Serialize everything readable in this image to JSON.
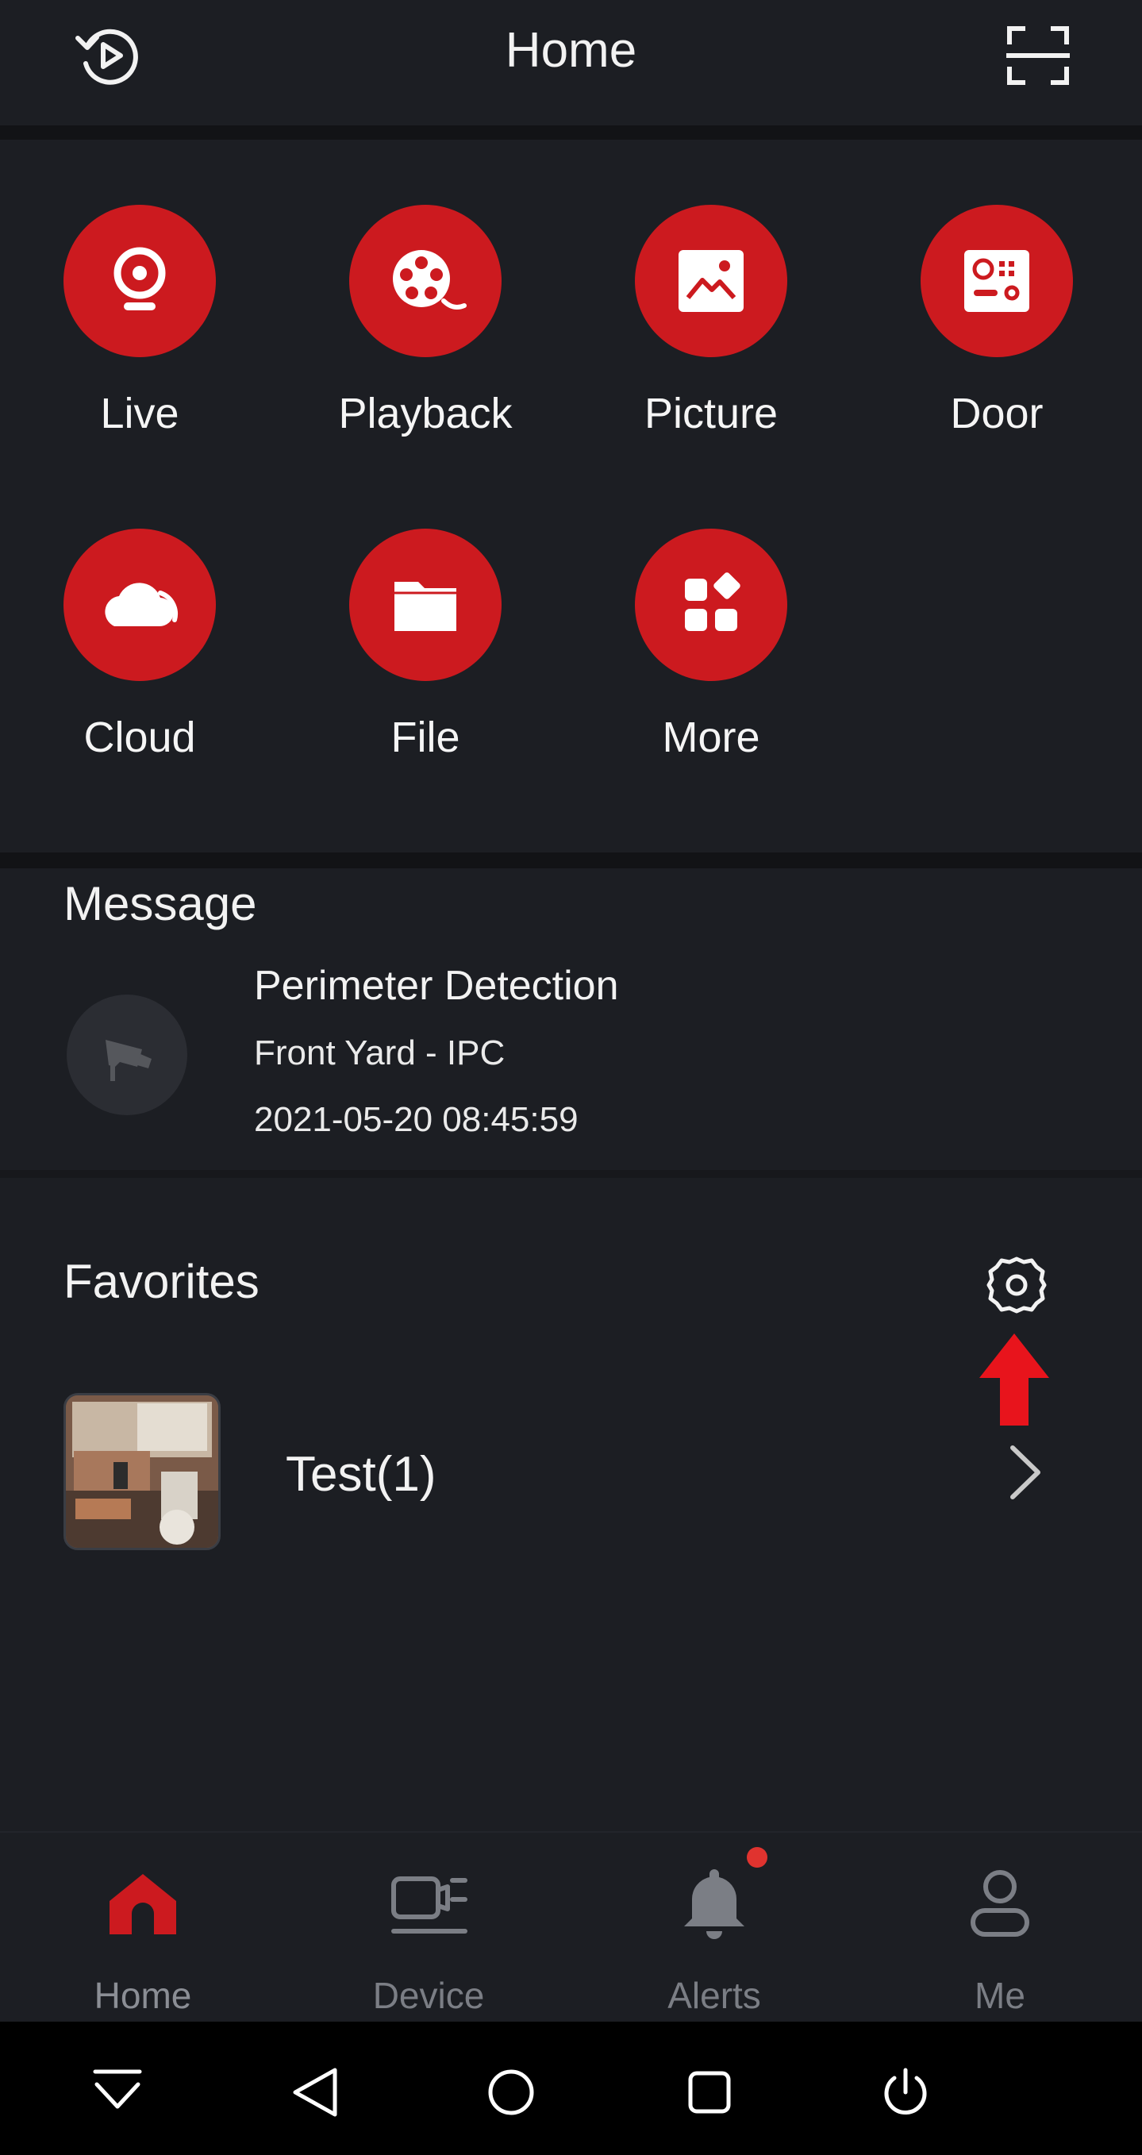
{
  "header": {
    "title": "Home",
    "left_icon": "replay-icon",
    "right_icon": "scan-icon"
  },
  "quick_actions": [
    {
      "label": "Live",
      "icon": "webcam-icon"
    },
    {
      "label": "Playback",
      "icon": "film-reel-icon"
    },
    {
      "label": "Picture",
      "icon": "image-icon"
    },
    {
      "label": "Door",
      "icon": "intercom-icon"
    },
    {
      "label": "Cloud",
      "icon": "cloud-icon"
    },
    {
      "label": "File",
      "icon": "folder-icon"
    },
    {
      "label": "More",
      "icon": "apps-grid-icon"
    }
  ],
  "message": {
    "heading": "Message",
    "title": "Perimeter Detection",
    "device": "Front Yard - IPC",
    "time": "2021-05-20 08:45:59",
    "icon": "security-camera-icon"
  },
  "favorites": {
    "heading": "Favorites",
    "settings_icon": "gear-icon",
    "items": [
      {
        "name": "Test(1)"
      }
    ]
  },
  "bottom_nav": [
    {
      "label": "Home",
      "icon": "home-icon",
      "active": true
    },
    {
      "label": "Device",
      "icon": "device-icon",
      "active": false
    },
    {
      "label": "Alerts",
      "icon": "bell-icon",
      "active": false,
      "badge": true
    },
    {
      "label": "Me",
      "icon": "user-icon",
      "active": false
    }
  ],
  "colors": {
    "accent": "#cc1a1f",
    "background": "#1c1e23",
    "separator": "#121316",
    "inactive": "#7b7e85",
    "badge": "#e0332f",
    "annotation_arrow": "#e8141c"
  }
}
